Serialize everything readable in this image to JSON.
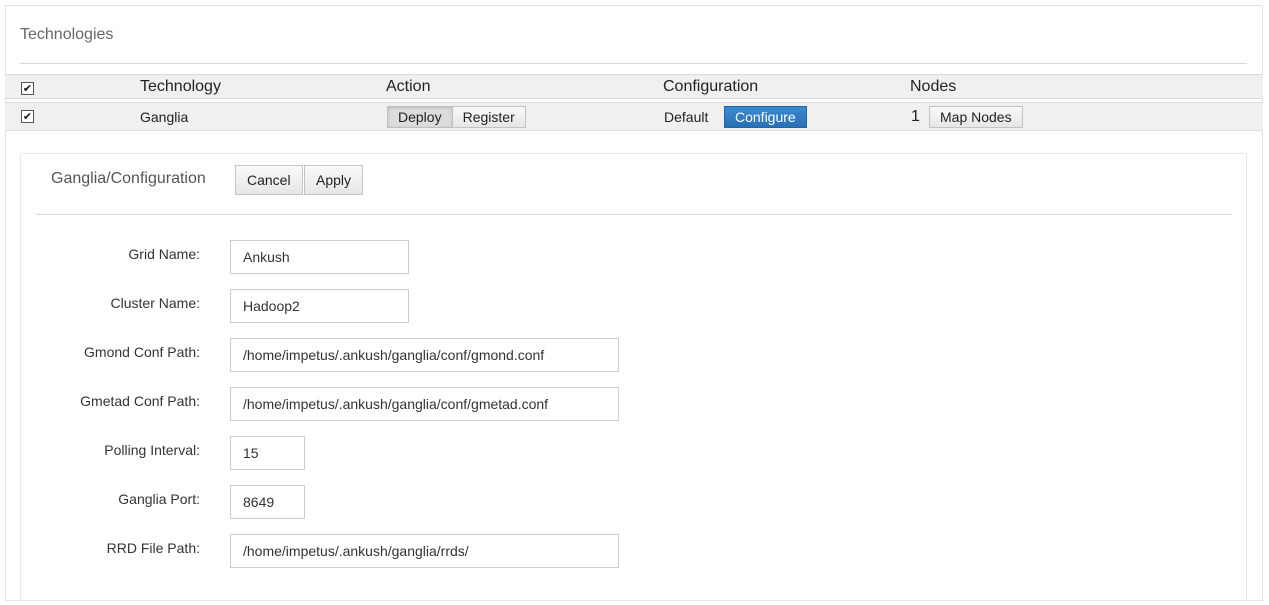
{
  "page": {
    "title": "Technologies"
  },
  "table": {
    "headers": {
      "technology": "Technology",
      "action": "Action",
      "configuration": "Configuration",
      "nodes": "Nodes"
    },
    "rows": [
      {
        "technology": "Ganglia",
        "actions": {
          "deploy": "Deploy",
          "register": "Register",
          "selected": "Deploy"
        },
        "configuration": {
          "value": "Default",
          "button": "Configure"
        },
        "nodes": {
          "count": "1",
          "button": "Map Nodes"
        }
      }
    ]
  },
  "config": {
    "title": "Ganglia/Configuration",
    "cancel": "Cancel",
    "apply": "Apply",
    "fields": {
      "grid_name": {
        "label": "Grid Name:",
        "value": "Ankush"
      },
      "cluster_name": {
        "label": "Cluster Name:",
        "value": "Hadoop2"
      },
      "gmond_conf_path": {
        "label": "Gmond Conf Path:",
        "value": "/home/impetus/.ankush/ganglia/conf/gmond.conf"
      },
      "gmetad_conf_path": {
        "label": "Gmetad Conf Path:",
        "value": "/home/impetus/.ankush/ganglia/conf/gmetad.conf"
      },
      "polling_interval": {
        "label": "Polling Interval:",
        "value": "15"
      },
      "ganglia_port": {
        "label": "Ganglia Port:",
        "value": "8649"
      },
      "rrd_file_path": {
        "label": "RRD File Path:",
        "value": "/home/impetus/.ankush/ganglia/rrds/"
      }
    }
  },
  "icons": {
    "checkbox_checked": "✔"
  },
  "colors": {
    "primary_button": "#2a6fb4",
    "row_background": "#f0f0f0"
  }
}
